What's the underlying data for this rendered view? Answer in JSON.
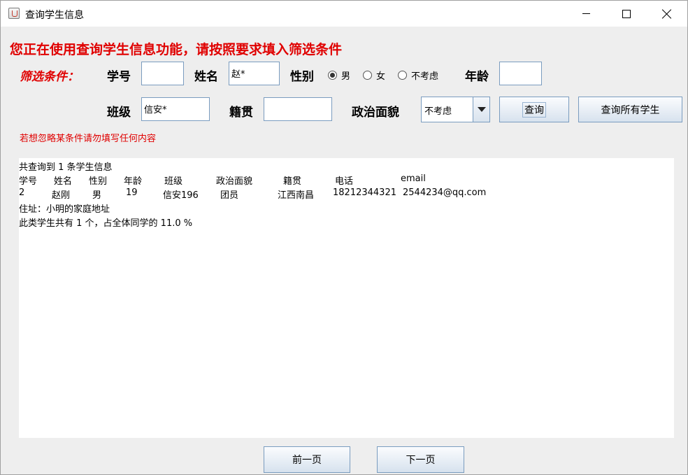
{
  "window": {
    "title": "查询学生信息"
  },
  "headline": "您正在使用查询学生信息功能，请按照要求填入筛选条件",
  "filter": {
    "label": "筛选条件：",
    "student_id_label": "学号",
    "student_id_value": "",
    "name_label": "姓名",
    "name_value": "赵*",
    "gender_label": "性别",
    "gender_options": [
      "男",
      "女",
      "不考虑"
    ],
    "gender_selected": "男",
    "age_label": "年龄",
    "age_value": "",
    "class_label": "班级",
    "class_value": "信安*",
    "native_label": "籍贯",
    "native_value": "",
    "political_label": "政治面貌",
    "political_value": "不考虑",
    "query_button": "查询",
    "query_all_button": "查询所有学生"
  },
  "hint": "若想忽略某条件请勿填写任何内容",
  "result": {
    "summary": "共查询到 1 条学生信息",
    "headers": [
      "学号",
      "姓名",
      "性别",
      "年龄",
      "班级",
      "政治面貌",
      "籍贯",
      "电话",
      "email"
    ],
    "row": [
      "2",
      "赵刚",
      "男",
      "19",
      "信安196",
      "团员",
      "江西南昌",
      "18212344321",
      "2544234@qq.com"
    ],
    "address": "住址：小明的家庭地址",
    "stats": "此类学生共有 1 个，占全体同学的 11.0 %"
  },
  "pagination": {
    "prev": "前一页",
    "next": "下一页"
  }
}
